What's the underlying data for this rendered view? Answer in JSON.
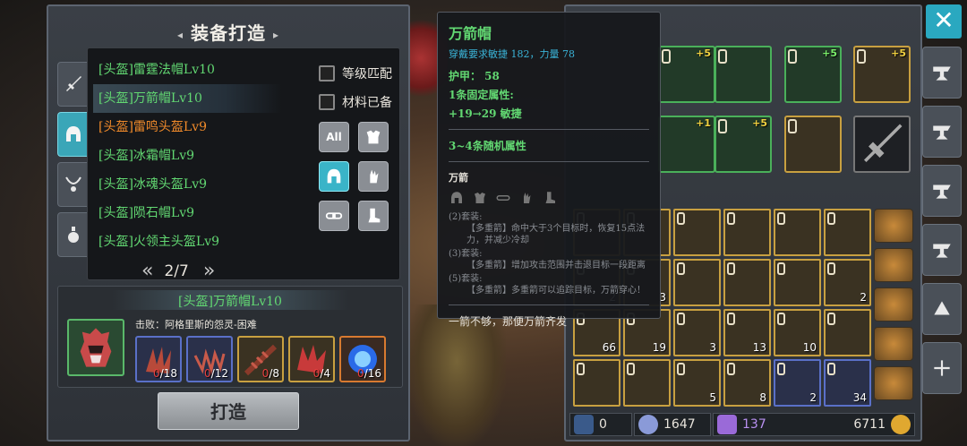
{
  "panel": {
    "title": "装备打造",
    "deco_left": "◂",
    "deco_right": "▸"
  },
  "categories": [
    {
      "icon": "sword-icon"
    },
    {
      "icon": "helmet-icon",
      "active": true
    },
    {
      "icon": "necklace-icon"
    },
    {
      "icon": "potion-icon"
    }
  ],
  "recipes": [
    {
      "label": "[头盔]雷霆法帽Lv10",
      "color": "green"
    },
    {
      "label": "[头盔]万箭帽Lv10",
      "color": "green",
      "selected": true
    },
    {
      "label": "[头盔]雷鸣头盔Lv9",
      "color": "orange"
    },
    {
      "label": "[头盔]冰霜帽Lv9",
      "color": "green"
    },
    {
      "label": "[头盔]冰魂头盔Lv9",
      "color": "green"
    },
    {
      "label": "[头盔]陨石帽Lv9",
      "color": "green"
    },
    {
      "label": "[头盔]火领主头盔Lv9",
      "color": "green"
    }
  ],
  "filters": {
    "level_match": "等级匹配",
    "materials_ready": "材料已备",
    "all_label": "All"
  },
  "pager": {
    "prev": "«",
    "next": "»",
    "current": "2/7"
  },
  "detail": {
    "title": "[头盔]万箭帽Lv10",
    "defeat": "击败：阿格里斯的怨灵-困难",
    "materials": [
      {
        "have": "0",
        "need": "/18",
        "style": "blue"
      },
      {
        "have": "0",
        "need": "/12",
        "style": "blue"
      },
      {
        "have": "0",
        "need": "/8",
        "style": "gold"
      },
      {
        "have": "0",
        "need": "/4",
        "style": "gold"
      },
      {
        "have": "0",
        "need": "/16",
        "style": "orange"
      }
    ]
  },
  "craft_button": "打造",
  "tooltip": {
    "name": "万箭帽",
    "requirement": "穿戴要求敏捷 182，力量 78",
    "armor": "护甲： 58",
    "fixed_attr_count": "1条固定属性:",
    "fixed_attr": "+19→29 敏捷",
    "random_attr": "3~4条随机属性",
    "set_name": "万箭",
    "set_bonus_2_head": "(2)套装:",
    "set_bonus_2_body": "【多重箭】命中大于3个目标时，恢复15点法力，并减少冷却",
    "set_bonus_3_head": "(3)套装:",
    "set_bonus_3_body": "【多重箭】增加攻击范围并击退目标一段距离",
    "set_bonus_5_head": "(5)套装:",
    "set_bonus_5_body": "【多重箭】多重箭可以追踪目标，万箭穿心！",
    "flavor": "一箭不够，那便万箭齐发"
  },
  "equipment": [
    {
      "plus": "+5",
      "style": "green"
    },
    {
      "plus": "",
      "style": "green"
    },
    {
      "plus": "+5",
      "style": "green"
    },
    {
      "plus": "+5",
      "style": "gold"
    },
    {
      "plus": "+1",
      "style": "green"
    },
    {
      "plus": "+5",
      "style": "green"
    },
    {
      "plus": "",
      "style": "gold"
    },
    {
      "plus": "",
      "style": "dark"
    }
  ],
  "inventory": [
    {
      "count": "",
      "style": "gold"
    },
    {
      "count": "",
      "style": "gold"
    },
    {
      "count": "",
      "style": "gold"
    },
    {
      "count": "",
      "style": "gold"
    },
    {
      "count": "",
      "style": "gold"
    },
    {
      "count": "",
      "style": "gold"
    },
    {
      "count": "2",
      "style": "gold"
    },
    {
      "count": "3",
      "style": "gold"
    },
    {
      "count": "",
      "style": "gold"
    },
    {
      "count": "",
      "style": "gold"
    },
    {
      "count": "",
      "style": "gold"
    },
    {
      "count": "2",
      "style": "gold"
    },
    {
      "count": "66",
      "style": "gold"
    },
    {
      "count": "19",
      "style": "gold"
    },
    {
      "count": "3",
      "style": "gold"
    },
    {
      "count": "13",
      "style": "gold"
    },
    {
      "count": "10",
      "style": "gold"
    },
    {
      "count": "",
      "style": "gold"
    },
    {
      "count": "",
      "style": "gold"
    },
    {
      "count": "",
      "style": "gold"
    },
    {
      "count": "5",
      "style": "gold"
    },
    {
      "count": "8",
      "style": "gold"
    },
    {
      "count": "2",
      "style": "blue"
    },
    {
      "count": "34",
      "style": "blue"
    }
  ],
  "currency": {
    "gems": "0",
    "crystals": "1647",
    "shards": "137",
    "gold": "6711"
  },
  "side_buttons": [
    "anvil-icon",
    "anvil-icon",
    "anvil-icon",
    "anvil-icon",
    "forge-icon",
    "craft-add-icon"
  ],
  "colors": {
    "accent": "#3ab4c8",
    "green_text": "#62d872",
    "orange_text": "#f08a2a",
    "gold_border": "#c8a040"
  }
}
